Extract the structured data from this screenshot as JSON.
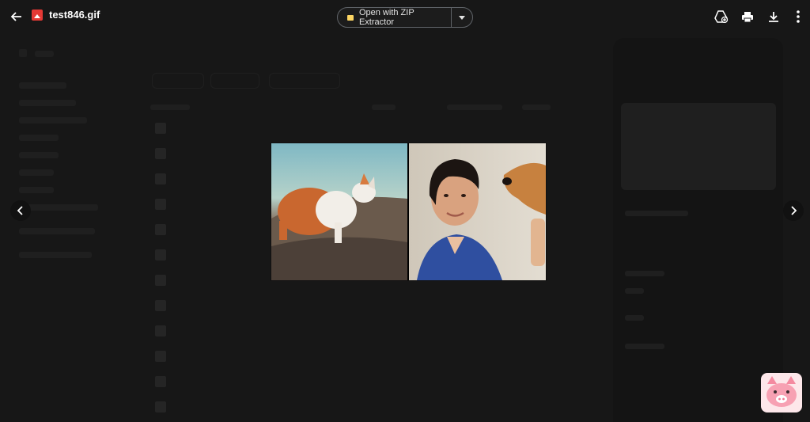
{
  "topbar": {
    "file_name": "test846.gif",
    "open_with_label": "Open with ZIP Extractor",
    "icons": [
      "back-arrow-icon",
      "image-file-icon",
      "add-to-drive-icon",
      "print-icon",
      "download-icon",
      "more-vert-icon",
      "chevron-down-icon"
    ]
  },
  "navigation": {
    "prev_icon": "chevron-left-icon",
    "next_icon": "chevron-right-icon"
  },
  "preview": {
    "frames": [
      "cat-on-rock",
      "woman-with-dog"
    ]
  },
  "colors": {
    "file_icon": "#e53935",
    "zip_icon": "#fdd663",
    "background": "#1f1f1f"
  }
}
